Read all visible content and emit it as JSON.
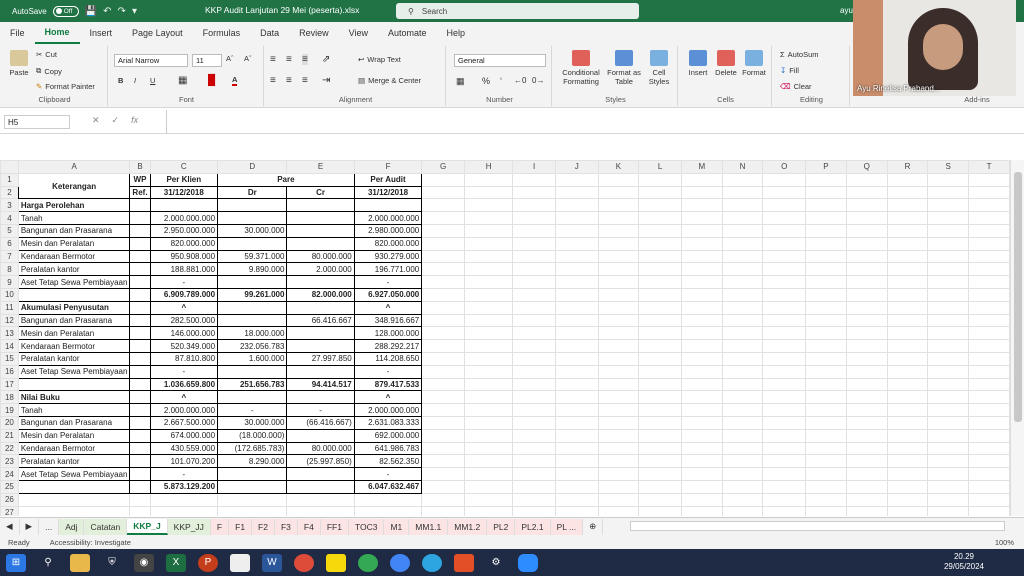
{
  "titlebar": {
    "autosave_label": "AutoSave",
    "autosave_state": "Off",
    "document_title": "KKP Audit Lanjutan 29 Mei (peserta).xlsx",
    "search_placeholder": "Search",
    "user_short": "ayu"
  },
  "ribbon_tabs": [
    "File",
    "Home",
    "Insert",
    "Page Layout",
    "Formulas",
    "Data",
    "Review",
    "View",
    "Automate",
    "Help"
  ],
  "ribbon": {
    "clipboard": {
      "paste": "Paste",
      "cut": "Cut",
      "copy": "Copy",
      "format_painter": "Format Painter",
      "label": "Clipboard"
    },
    "font": {
      "name": "Arial Narrow",
      "size": "11",
      "label": "Font",
      "bold": "B",
      "italic": "I",
      "underline": "U"
    },
    "alignment": {
      "wrap": "Wrap Text",
      "merge": "Merge & Center",
      "label": "Alignment"
    },
    "number": {
      "format": "General",
      "label": "Number",
      "percent": "%"
    },
    "styles": {
      "conditional": "Conditional Formatting",
      "format_table": "Format as Table",
      "cell_styles": "Cell Styles",
      "label": "Styles"
    },
    "cells": {
      "insert": "Insert",
      "delete": "Delete",
      "format": "Format",
      "label": "Cells"
    },
    "editing": {
      "autosum": "AutoSum",
      "fill": "Fill",
      "clear": "Clear",
      "label": "Editing"
    },
    "addins": {
      "label": "Add-ins"
    }
  },
  "formula_bar": {
    "name_box": "H5",
    "fx": "fx",
    "value": ""
  },
  "columns": [
    "A",
    "B",
    "C",
    "D",
    "E",
    "F",
    "G",
    "H",
    "I",
    "J",
    "K",
    "L",
    "M",
    "N",
    "O",
    "P",
    "Q",
    "R",
    "S",
    "T"
  ],
  "sheet": {
    "header": {
      "keterangan": "Keterangan",
      "wp": "WP",
      "ref": "Ref.",
      "per_klien": "Per Klien",
      "date1": "31/12/2018",
      "pare": "Pare",
      "dr": "Dr",
      "cr": "Cr",
      "per_audit": "Per Audit",
      "date2": "31/12/2018"
    },
    "rows": [
      {
        "n": "3",
        "a": "Harga Perolehan",
        "bold": true,
        "c": "",
        "d": "",
        "e": "",
        "f": ""
      },
      {
        "n": "4",
        "a": "Tanah",
        "c": "2.000.000.000",
        "d": "",
        "e": "",
        "f": "2.000.000.000"
      },
      {
        "n": "5",
        "a": "Bangunan dan Prasarana",
        "c": "2.950.000.000",
        "d": "30.000.000",
        "e": "",
        "f": "2.980.000.000"
      },
      {
        "n": "6",
        "a": "Mesin dan Peralatan",
        "c": "820.000.000",
        "d": "",
        "e": "",
        "f": "820.000.000"
      },
      {
        "n": "7",
        "a": "Kendaraan Bermotor",
        "c": "950.908.000",
        "d": "59.371.000",
        "e": "80.000.000",
        "f": "930.279.000"
      },
      {
        "n": "8",
        "a": "Peralatan kantor",
        "c": "188.881.000",
        "d": "9.890.000",
        "e": "2.000.000",
        "f": "196.771.000"
      },
      {
        "n": "9",
        "a": "Aset Tetap Sewa Pembiayaan",
        "c": "-",
        "d": "",
        "e": "",
        "f": "-"
      },
      {
        "n": "10",
        "a": "",
        "bold": true,
        "c": "6.909.789.000",
        "d": "99.261.000",
        "e": "82.000.000",
        "f": "6.927.050.000"
      },
      {
        "n": "11",
        "a": "Akumulasi Penyusutan",
        "bold": true,
        "c": "^",
        "d": "",
        "e": "",
        "f": "^"
      },
      {
        "n": "12",
        "a": "Bangunan dan Prasarana",
        "c": "282.500.000",
        "d": "",
        "e": "66.416.667",
        "f": "348.916.667"
      },
      {
        "n": "13",
        "a": "Mesin dan Peralatan",
        "c": "146.000.000",
        "d": "18.000.000",
        "e": "",
        "f": "128.000.000"
      },
      {
        "n": "14",
        "a": "Kendaraan Bermotor",
        "c": "520.349.000",
        "d": "232.056.783",
        "e": "",
        "f": "288.292.217"
      },
      {
        "n": "15",
        "a": "Peralatan kantor",
        "c": "87.810.800",
        "d": "1.600.000",
        "e": "27.997.850",
        "f": "114.208.650"
      },
      {
        "n": "16",
        "a": "Aset Tetap Sewa Pembiayaan",
        "c": "-",
        "d": "",
        "e": "",
        "f": "-"
      },
      {
        "n": "17",
        "a": "",
        "bold": true,
        "c": "1.036.659.800",
        "d": "251.656.783",
        "e": "94.414.517",
        "f": "879.417.533"
      },
      {
        "n": "18",
        "a": "Nilai Buku",
        "bold": true,
        "c": "^",
        "d": "",
        "e": "",
        "f": "^"
      },
      {
        "n": "19",
        "a": "Tanah",
        "c": "2.000.000.000",
        "d": "-",
        "e": "-",
        "f": "2.000.000.000"
      },
      {
        "n": "20",
        "a": "Bangunan dan Prasarana",
        "c": "2.667.500.000",
        "d": "30.000.000",
        "e": "(66.416.667)",
        "f": "2.631.083.333"
      },
      {
        "n": "21",
        "a": "Mesin dan Peralatan",
        "c": "674.000.000",
        "d": "(18.000.000)",
        "e": "",
        "f": "692.000.000"
      },
      {
        "n": "22",
        "a": "Kendaraan Bermotor",
        "c": "430.559.000",
        "d": "(172.685.783)",
        "e": "80.000.000",
        "f": "641.986.783"
      },
      {
        "n": "23",
        "a": "Peralatan kantor",
        "c": "101.070.200",
        "d": "8.290.000",
        "e": "(25.997.850)",
        "f": "82.562.350"
      },
      {
        "n": "24",
        "a": "Aset Tetap Sewa Pembiayaan",
        "c": "-",
        "d": "",
        "e": "",
        "f": "-"
      },
      {
        "n": "25",
        "a": "",
        "bold": true,
        "c": "5.873.129.200",
        "d": "",
        "e": "",
        "f": "6.047.632.467"
      },
      {
        "n": "26",
        "a": "",
        "c": "",
        "d": "",
        "e": "",
        "f": ""
      },
      {
        "n": "27",
        "a": "",
        "c": "",
        "d": "",
        "e": "",
        "f": ""
      }
    ]
  },
  "sheet_tabs": [
    {
      "label": "...",
      "style": "plain"
    },
    {
      "label": "Adj",
      "style": "green"
    },
    {
      "label": "Catatan",
      "style": "green"
    },
    {
      "label": "KKP_J",
      "style": "active"
    },
    {
      "label": "KKP_JJ",
      "style": "green"
    },
    {
      "label": "F",
      "style": "pink"
    },
    {
      "label": "F1",
      "style": "pink"
    },
    {
      "label": "F2",
      "style": "pink"
    },
    {
      "label": "F3",
      "style": "pink"
    },
    {
      "label": "F4",
      "style": "pink"
    },
    {
      "label": "FF1",
      "style": "pink"
    },
    {
      "label": "TOC3",
      "style": "pink"
    },
    {
      "label": "M1",
      "style": "pink"
    },
    {
      "label": "MM1.1",
      "style": "pink"
    },
    {
      "label": "MM1.2",
      "style": "pink"
    },
    {
      "label": "PL2",
      "style": "pink"
    },
    {
      "label": "PL2.1",
      "style": "pink"
    },
    {
      "label": "PL ...",
      "style": "pink"
    }
  ],
  "statusbar": {
    "ready": "Ready",
    "accessibility": "Accessibility: Investigate",
    "zoom": "100%"
  },
  "video": {
    "name": "Ayu Rinelisa Praband..."
  },
  "clock": {
    "time": "20.29",
    "date": "29/05/2024"
  }
}
